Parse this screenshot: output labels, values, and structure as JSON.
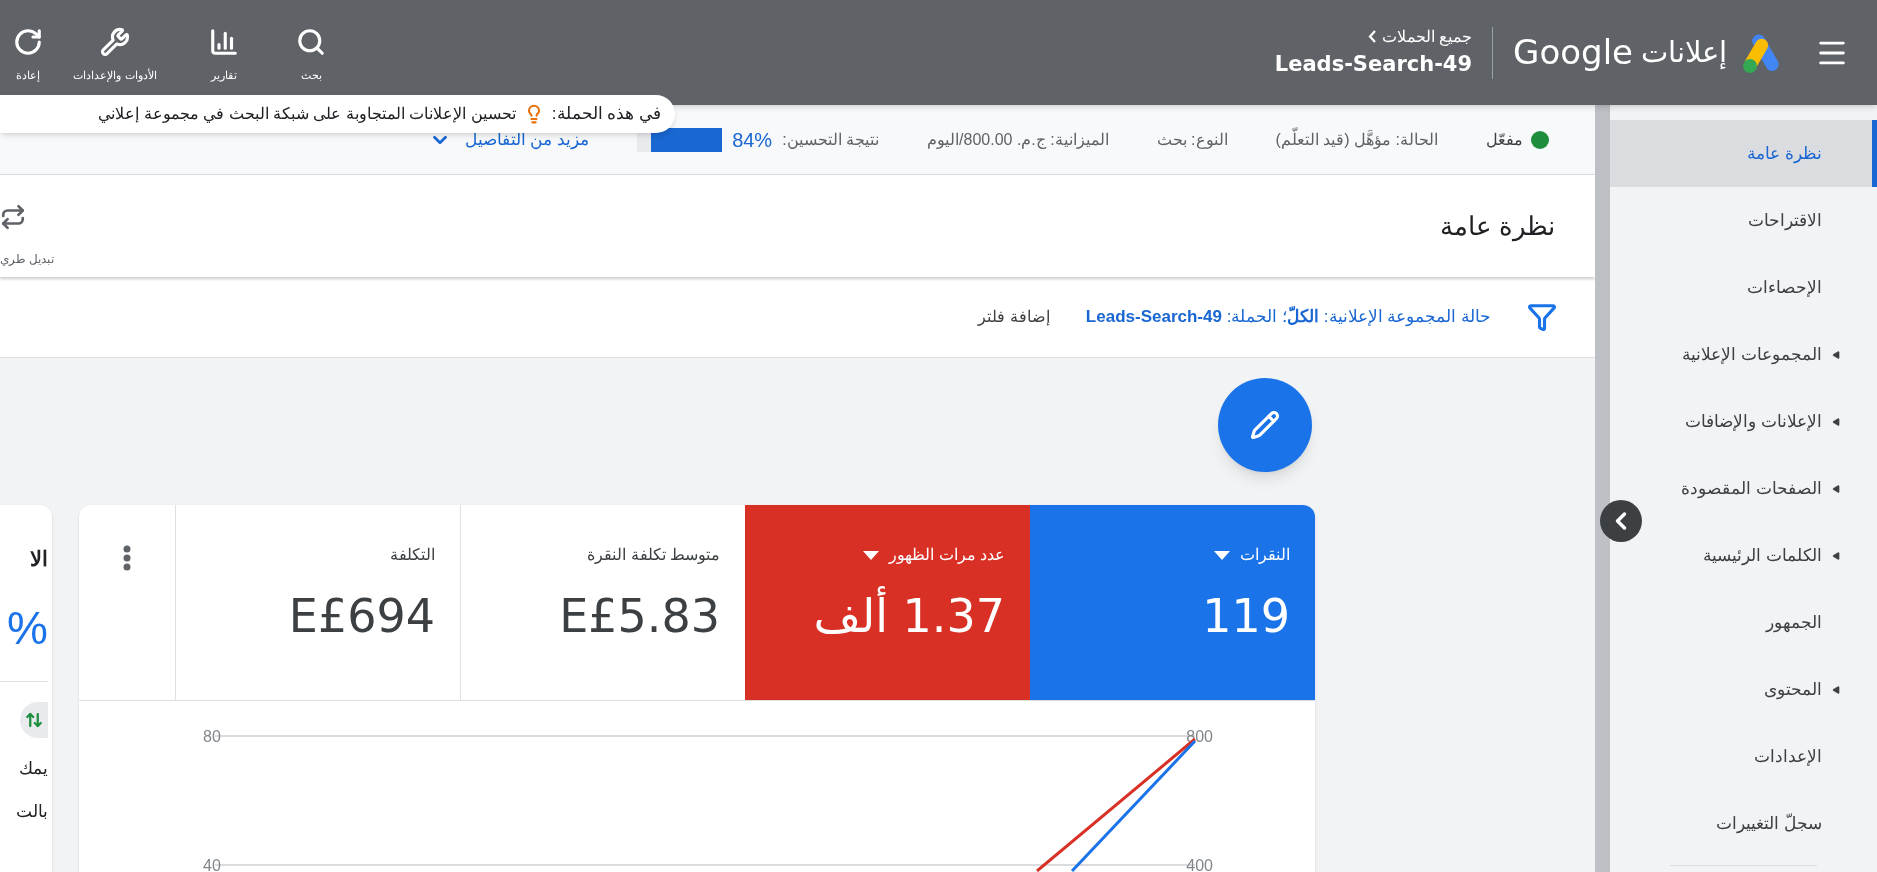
{
  "top_bar": {
    "product": "إعلانات",
    "brand": "Google",
    "breadcrumb": {
      "parent": "جميع الحملات",
      "current": "Leads-Search-49"
    },
    "tools": [
      {
        "kind": "search",
        "label": "بحث"
      },
      {
        "kind": "reports",
        "label": "تقارير"
      },
      {
        "kind": "tools",
        "label": "الأدوات والإعدادات"
      },
      {
        "kind": "refresh",
        "label": "إعادة"
      }
    ]
  },
  "tip_bubble": {
    "lead": "في هذه الحملة:",
    "text": "تحسين الإعلانات المتجاوبة على شبكة البحث في مجموعة إعلاني"
  },
  "status_row": {
    "status": "مفعّل",
    "fields": [
      "الحالة: مؤهَّل (قيد التعلّم)",
      "النوع: بحث",
      "الميزانية: ج.م. 800.00/اليوم"
    ],
    "score_label": "نتيجة التحسين:",
    "score": "84%",
    "level": 0.84,
    "details_link": "مزيد من التفاصيل"
  },
  "page_header": {
    "title": "نظرة عامة",
    "action": "تبديل طري"
  },
  "filter_bar": {
    "filter": "حالة المجموعة الإعلانية: **الكلّ**؛ الحملة: **Leads-Search-49**",
    "add_filter": "إضافة فلتر"
  },
  "metrics": [
    {
      "label": "النقرات",
      "value": "119",
      "selected": true,
      "color": "#1a73e8"
    },
    {
      "label": "عدد مرات الظهور",
      "value": "1.37 ألف",
      "selected": true,
      "color": "#d93025"
    },
    {
      "label": "متوسط تكلفة النقرة",
      "value": "E£5.83",
      "selected": false
    },
    {
      "label": "التكلفة",
      "value": "E£694",
      "selected": false
    }
  ],
  "chart": {
    "left_axis_labels": [
      "80",
      "40"
    ],
    "right_axis_labels": [
      "800",
      "400"
    ]
  },
  "side_card": {
    "title": "الا",
    "score": "%",
    "lines": [
      "يمك",
      "بالت"
    ]
  },
  "sidebar": {
    "items": [
      {
        "label": "نظرة عامة",
        "selected": true,
        "expandable": false
      },
      {
        "label": "الاقتراحات",
        "selected": false,
        "expandable": false
      },
      {
        "label": "الإحصاءات",
        "selected": false,
        "expandable": false
      },
      {
        "label": "المجموعات الإعلانية",
        "selected": false,
        "expandable": true
      },
      {
        "label": "الإعلانات والإضافات",
        "selected": false,
        "expandable": true
      },
      {
        "label": "الصفحات المقصودة",
        "selected": false,
        "expandable": true
      },
      {
        "label": "الكلمات الرئيسية",
        "selected": false,
        "expandable": true
      },
      {
        "label": "الجمهور",
        "selected": false,
        "expandable": false
      },
      {
        "label": "المحتوى",
        "selected": false,
        "expandable": true
      },
      {
        "label": "الإعدادات",
        "selected": false,
        "expandable": false
      },
      {
        "label": "سجلّ التغييرات",
        "selected": false,
        "expandable": false
      }
    ]
  }
}
